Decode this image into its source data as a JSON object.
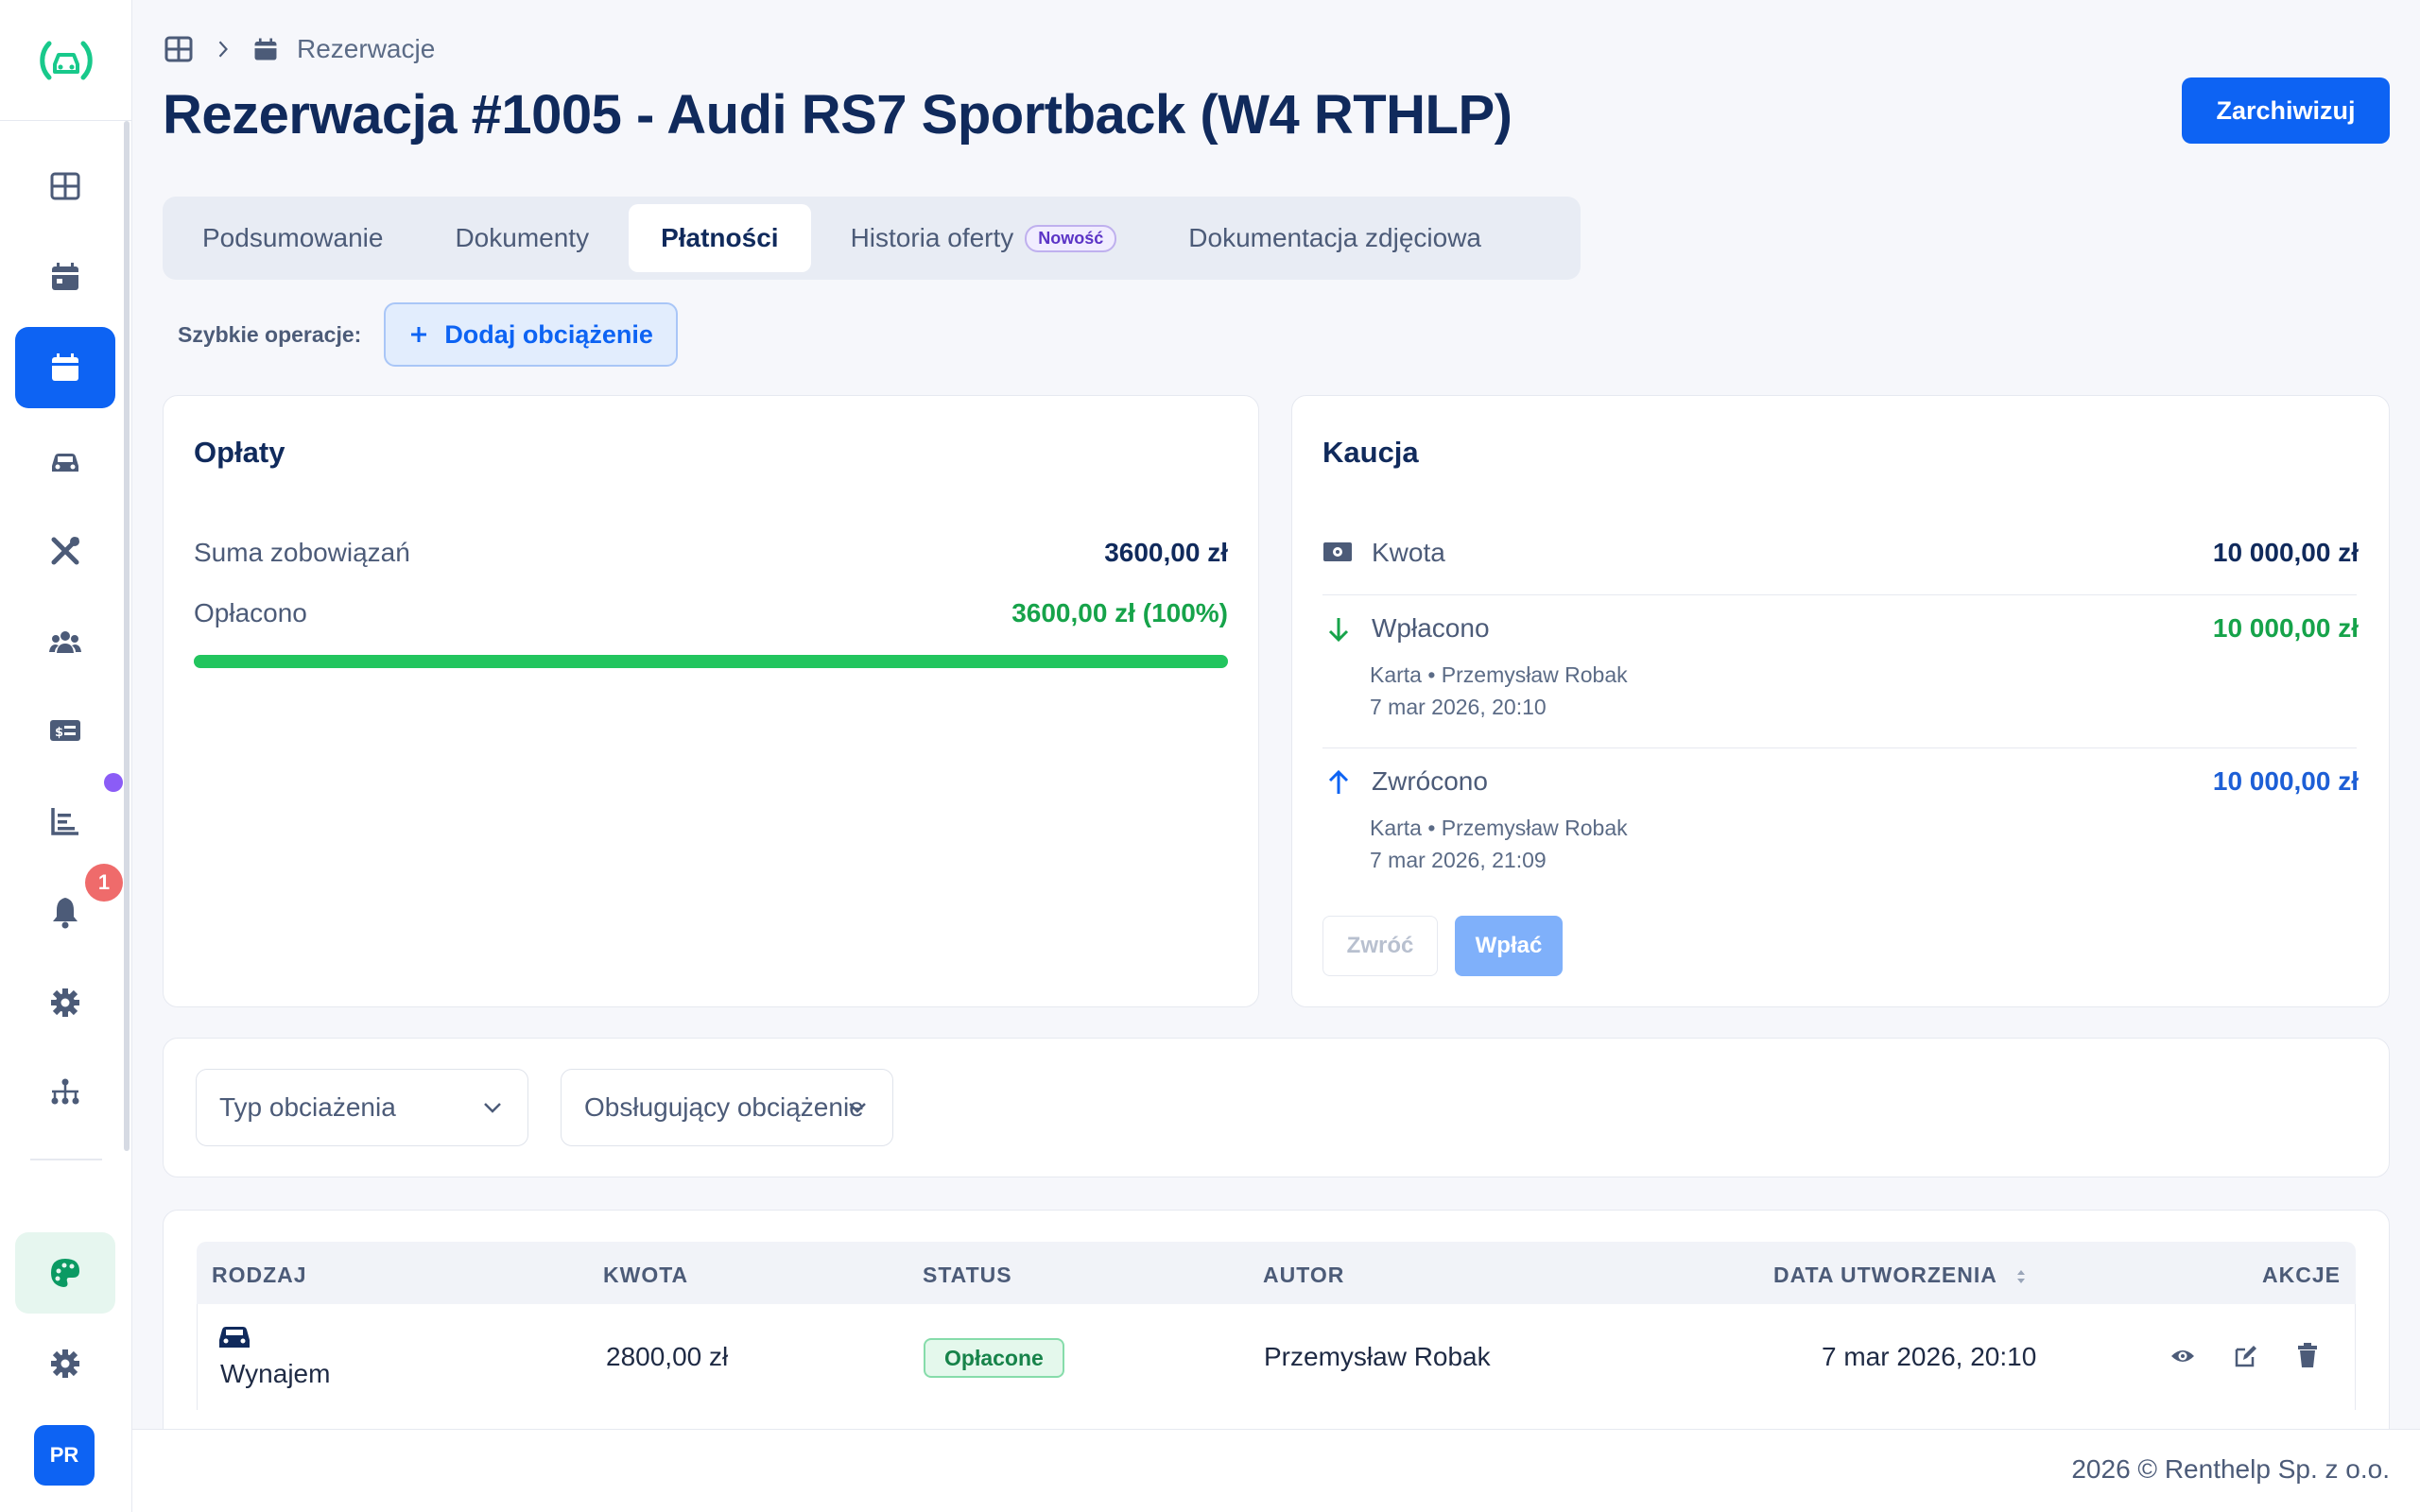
{
  "sidebar": {
    "nav": [
      {
        "icon": "dashboard-icon"
      },
      {
        "icon": "calendar-icon"
      },
      {
        "icon": "reservations-calendar-icon",
        "active": true
      },
      {
        "icon": "car-icon"
      },
      {
        "icon": "tools-icon"
      },
      {
        "icon": "users-icon"
      },
      {
        "icon": "billing-card-icon"
      },
      {
        "icon": "chart-icon"
      },
      {
        "icon": "bell-icon"
      },
      {
        "icon": "gear-icon"
      },
      {
        "icon": "integrations-icon"
      }
    ],
    "notification_count": "1",
    "bottom": {
      "theme_icon": "palette-icon",
      "settings_icon": "gear-icon",
      "avatar_initials": "PR"
    }
  },
  "breadcrumb": {
    "home_icon": "dashboard-icon",
    "separator_icon": "chevron-right-icon",
    "section_icon": "calendar-icon",
    "section": "Rezerwacje"
  },
  "header": {
    "title": "Rezerwacja #1005 - Audi RS7 Sportback (W4 RTHLP)",
    "archive_label": "Zarchiwizuj"
  },
  "tabs": [
    {
      "label": "Podsumowanie"
    },
    {
      "label": "Dokumenty"
    },
    {
      "label": "Płatności",
      "active": true
    },
    {
      "label": "Historia oferty",
      "badge": "Nowość"
    },
    {
      "label": "Dokumentacja zdjęciowa"
    }
  ],
  "quick_ops": {
    "label": "Szybkie operacje:",
    "add_charge_label": "Dodaj obciążenie"
  },
  "fees": {
    "title": "Opłaty",
    "total_label": "Suma zobowiązań",
    "total_value": "3600,00 zł",
    "paid_label": "Opłacono",
    "paid_value": "3600,00 zł (100%)",
    "paid_fraction": 1.0
  },
  "deposit": {
    "title": "Kaucja",
    "amount_label": "Kwota",
    "amount_value": "10 000,00 zł",
    "deposited_label": "Wpłacono",
    "deposited_value": "10 000,00 zł",
    "deposited_method": "Karta • Przemysław Robak",
    "deposited_date": "7 mar 2026, 20:10",
    "returned_label": "Zwrócono",
    "returned_value": "10 000,00 zł",
    "returned_method": "Karta • Przemysław Robak",
    "returned_date": "7 mar 2026, 21:09",
    "return_button": "Zwróć",
    "deposit_button": "Wpłać"
  },
  "filters": {
    "type_label": "Typ obciażenia",
    "handler_label": "Obsługujący obciążenie"
  },
  "table": {
    "columns": [
      "RODZAJ",
      "KWOTA",
      "STATUS",
      "AUTOR",
      "DATA UTWORZENIA",
      "AKCJE"
    ],
    "rows": [
      {
        "type_icon": "car-icon",
        "type": "Wynajem",
        "amount": "2800,00 zł",
        "status": "Opłacone",
        "author": "Przemysław Robak",
        "created": "7 mar 2026, 20:10"
      }
    ]
  },
  "footer": {
    "text": "2026 © Renthelp Sp. z o.o."
  },
  "colors": {
    "primary": "#0d63f3",
    "title": "#102a5c",
    "success": "#16a34a",
    "progress": "#22c55e",
    "logo": "#18c98b"
  }
}
